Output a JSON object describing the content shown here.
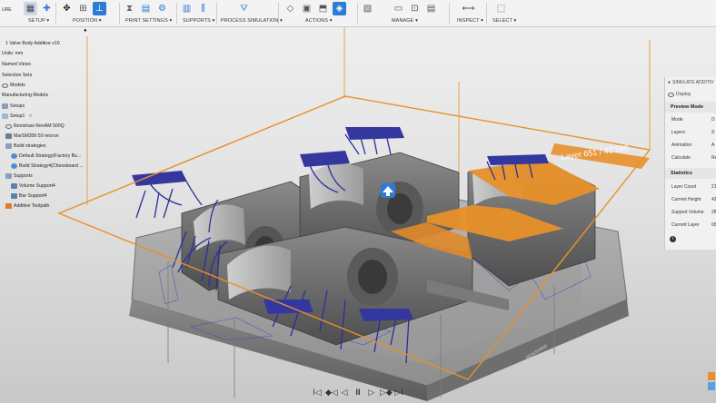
{
  "toolbar": {
    "groups": [
      {
        "label": "SETUP ▾"
      },
      {
        "label": "POSITION ▾"
      },
      {
        "label": "PRINT SETTINGS ▾"
      },
      {
        "label": "SUPPORTS ▾"
      },
      {
        "label": "PROCESS SIMULATION ▾"
      },
      {
        "label": "ACTIONS ▾"
      },
      {
        "label": "MANAGE ▾"
      },
      {
        "label": "INSPECT ▾"
      },
      {
        "label": "SELECT ▾"
      }
    ],
    "left_fragment": "URE"
  },
  "browser": {
    "items": [
      {
        "label": "1 Valve Body Additive v10"
      },
      {
        "label": "Units: mm"
      },
      {
        "label": "Named Views"
      },
      {
        "label": "Selection Sets"
      },
      {
        "label": "Models"
      },
      {
        "label": "Manufacturing Models"
      },
      {
        "label": "Setups"
      },
      {
        "label": "Setup1"
      },
      {
        "label": "Renishaw RenAM 500Q"
      },
      {
        "label": "MarSM300 50 micron"
      },
      {
        "label": "Build strategies"
      },
      {
        "label": "Default Strategy(Factory Bu..."
      },
      {
        "label": "Build Strategy4(Chessboard ..."
      },
      {
        "label": "Supports"
      },
      {
        "label": "Volume Support4"
      },
      {
        "label": "Bar Support4"
      },
      {
        "label": "Additive Toolpath"
      }
    ]
  },
  "viewport": {
    "layer_label": "Layer 651 / 42 580",
    "bed_text": "RENISHAW"
  },
  "panel": {
    "title": "SIMULATE ADDITIV",
    "display_label": "Display",
    "preview_section": "Preview Mode",
    "preview_rows": [
      {
        "label": "Mode",
        "value": "D"
      },
      {
        "label": "Layers",
        "value": "S"
      },
      {
        "label": "Animation",
        "value": "A"
      },
      {
        "label": "Calculate",
        "value": "Re"
      }
    ],
    "stats_section": "Statistics",
    "stats_rows": [
      {
        "label": "Layer Count",
        "value": "21"
      },
      {
        "label": "Current Height",
        "value": "42"
      },
      {
        "label": "Support Volume",
        "value": "28"
      },
      {
        "label": "Current Layer",
        "value": "65"
      }
    ],
    "info_icon": "info-icon"
  },
  "playback": {
    "buttons": [
      "I◁",
      "◆◁",
      "◁",
      "II",
      "▷",
      "▷◆",
      "▷I"
    ]
  },
  "colors": {
    "accent": "#e8902a",
    "support_blue": "#2b2f9a",
    "part_grey": "#6a6a6a",
    "toolbar_bg": "#f3f3f3"
  }
}
